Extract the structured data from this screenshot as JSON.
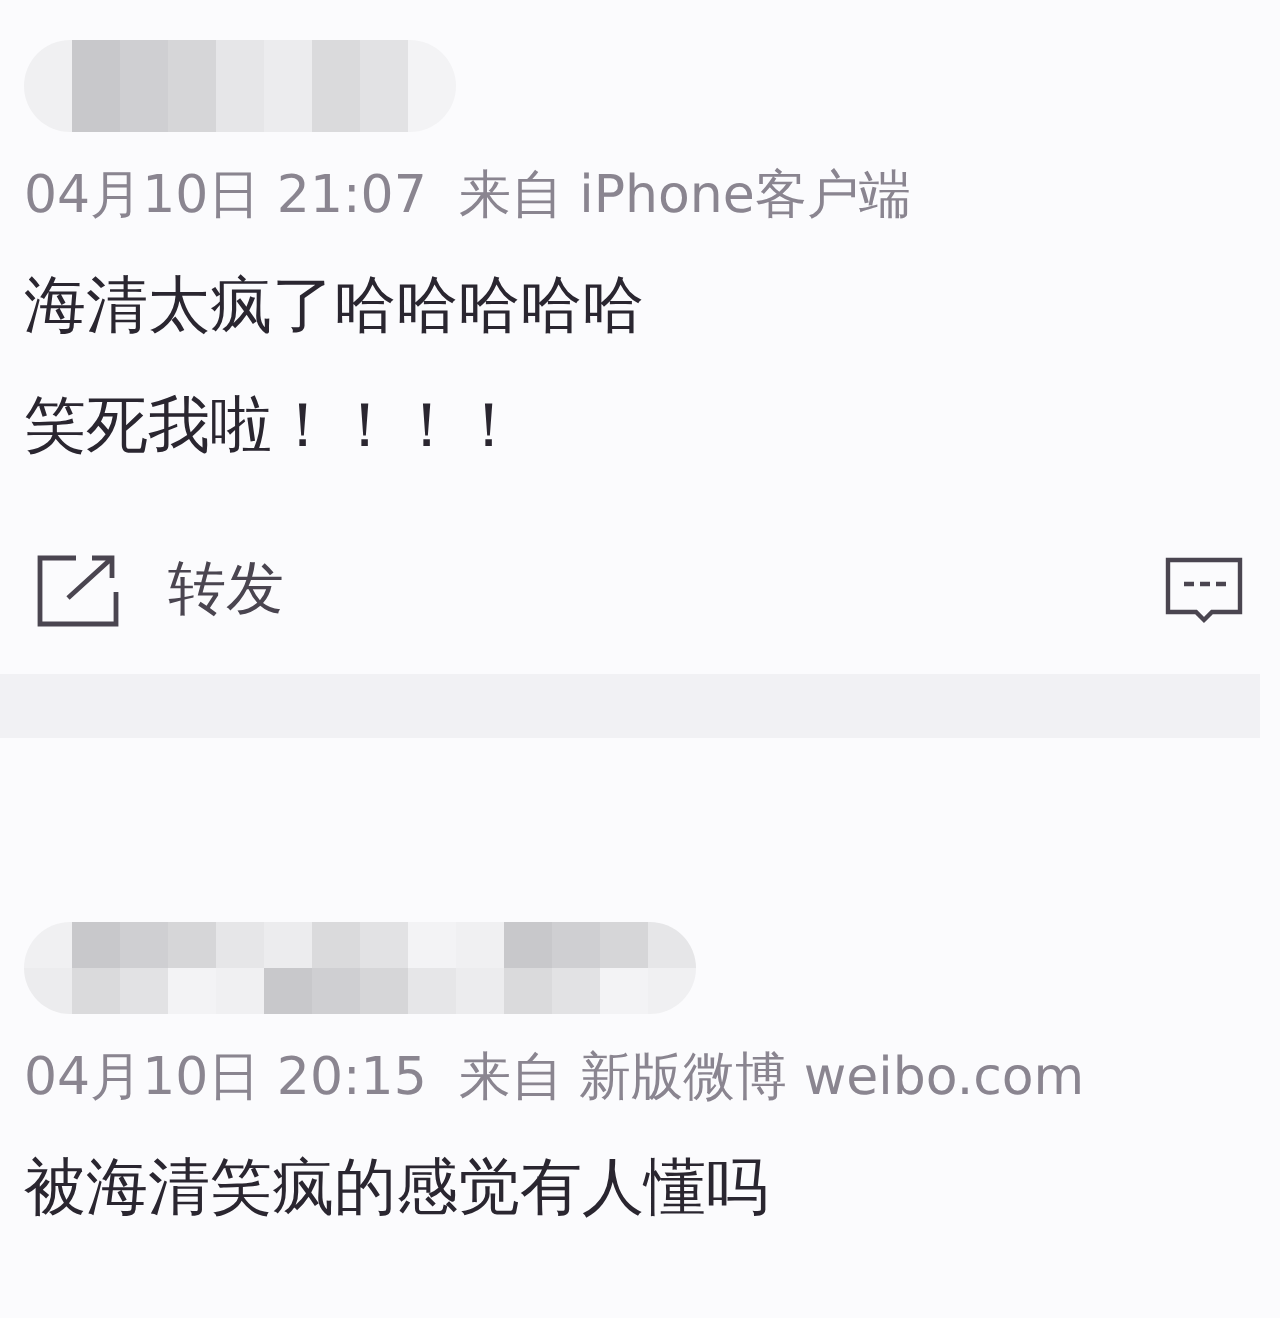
{
  "posts": [
    {
      "author": {
        "kind": "redacted"
      },
      "time": "04月10日 21:07",
      "source": "来自 iPhone客户端",
      "lines": [
        "海清太疯了哈哈哈哈哈",
        "笑死我啦！！！！"
      ],
      "actions": {
        "repost": "转发"
      }
    },
    {
      "author": {
        "kind": "redacted"
      },
      "time": "04月10日 20:15",
      "source": "来自 新版微博 weibo.com",
      "lines": [
        "被海清笑疯的感觉有人懂吗"
      ]
    }
  ]
}
